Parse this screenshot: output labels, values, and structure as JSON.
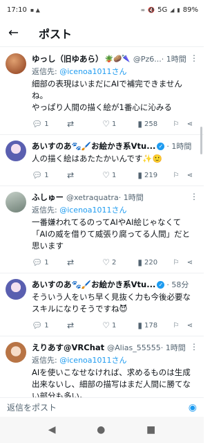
{
  "status": {
    "time": "17:10",
    "network": "5G",
    "battery": "89%"
  },
  "header": {
    "title": "ポスト"
  },
  "tweets": [
    {
      "name": "ゆっし（旧ゆあら）",
      "emoji": "🪴🥔🌂",
      "handle": "@Pz6...",
      "time": "· 1時間",
      "reply_prefix": "返信先: ",
      "reply_to": "@icenoa1011さん",
      "text": "細部の表現はいまだにAIで補完できませんね。\nやっぱり人間の描く絵が1番心に沁みる",
      "replies": "1",
      "retweets": "",
      "likes": "1",
      "views": "258",
      "avatar_color": "#b3542c"
    },
    {
      "name": "あいすのあ🐾🖌️お絵かき系Vtu...",
      "verified": true,
      "handle": "",
      "time": "· 1時間",
      "reply_prefix": "",
      "reply_to": "",
      "text": "人の描く絵はあたたかいんです✨🙂",
      "replies": "1",
      "retweets": "",
      "likes": "1",
      "views": "219",
      "avatar_color": "#6b6fb8"
    },
    {
      "name": "ふしゅー",
      "handle": "@xetraquatra",
      "time": "· 1時間",
      "reply_prefix": "返信先: ",
      "reply_to": "@icenoa1011さん",
      "text": "一番嫌われてるのってAIやAI絵じゃなくて\n「AIの威を借りて威張り腐ってる人間」だと思います",
      "replies": "1",
      "retweets": "",
      "likes": "2",
      "views": "220",
      "avatar_color": "#8a9a90"
    },
    {
      "name": "あいすのあ🐾🖌️お絵かき系Vtu...",
      "verified": true,
      "handle": "",
      "time": "· 58分",
      "reply_prefix": "",
      "reply_to": "",
      "text": "そういう人をいち早く見抜く力も今後必要なスキルになりそうですね😈",
      "replies": "1",
      "retweets": "",
      "likes": "1",
      "views": "178",
      "avatar_color": "#6b6fb8"
    },
    {
      "name": "えりあす@VRChat",
      "handle": "@Alias_55555",
      "time": "· 1時間",
      "reply_prefix": "返信先: ",
      "reply_to": "@icenoa1011さん",
      "text": "AIを使いこなせなければ、求めるものは生成出来ないし、細部の描写はまだ人間に勝てない部分も多い。\n\nAIによって、失われる経済圏もあれば、新たに発生する経済圏もある。\n\nどちらが正しいとも言い難いな～",
      "replies": "",
      "retweets": "",
      "likes": "",
      "views": "",
      "avatar_color": "#c98b5a"
    }
  ],
  "composer": {
    "placeholder": "返信をポスト"
  },
  "icons": {
    "back": "arrow-left-icon",
    "reply": "speech-bubble-icon",
    "retweet": "retweet-icon",
    "like": "heart-icon",
    "views": "bar-chart-icon",
    "bookmark": "bookmark-icon",
    "share": "share-icon",
    "camera": "camera-icon"
  },
  "colors": {
    "accent": "#1d9bf0",
    "secondary_text": "#536471"
  }
}
